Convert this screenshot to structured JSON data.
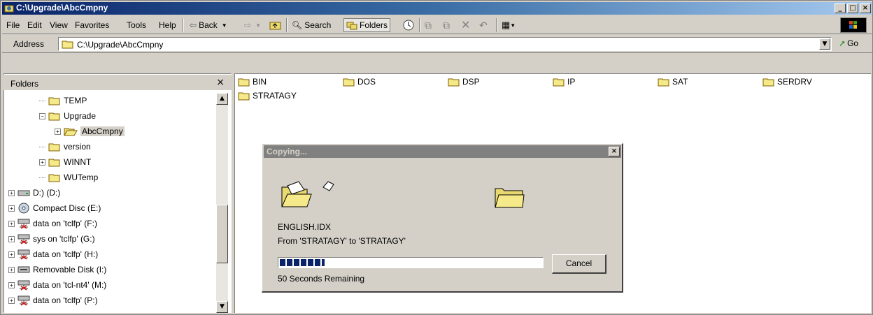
{
  "window": {
    "title": "C:\\Upgrade\\AbcCmpny",
    "controls": {
      "minimize": "_",
      "maximize": "□",
      "close": "×"
    }
  },
  "menu": {
    "file": "File",
    "edit": "Edit",
    "view": "View",
    "favorites": "Favorites",
    "tools": "Tools",
    "help": "Help"
  },
  "toolbar": {
    "back": "Back",
    "search": "Search",
    "folders": "Folders"
  },
  "address": {
    "label": "Address",
    "value": "C:\\Upgrade\\AbcCmpny",
    "go": "Go"
  },
  "folders_pane": {
    "title": "Folders",
    "close": "×",
    "tree": [
      {
        "label": "TEMP",
        "level": 2,
        "expander": ""
      },
      {
        "label": "Upgrade",
        "level": 2,
        "expander": "−"
      },
      {
        "label": "AbcCmpny",
        "level": 3,
        "expander": "+",
        "selected": true,
        "open": true
      },
      {
        "label": "version",
        "level": 2,
        "expander": ""
      },
      {
        "label": "WINNT",
        "level": 2,
        "expander": "+"
      },
      {
        "label": "WUTemp",
        "level": 2,
        "expander": ""
      },
      {
        "label": "D:) (D:)",
        "level": 0,
        "expander": "+",
        "icon": "drive-icon"
      },
      {
        "label": "Compact Disc (E:)",
        "level": 0,
        "expander": "+",
        "icon": "cd-icon"
      },
      {
        "label": "data on 'tclfp' (F:)",
        "level": 0,
        "expander": "+",
        "icon": "network-drive-icon"
      },
      {
        "label": "sys on 'tclfp' (G:)",
        "level": 0,
        "expander": "+",
        "icon": "network-drive-icon"
      },
      {
        "label": "data on 'tclfp' (H:)",
        "level": 0,
        "expander": "+",
        "icon": "network-drive-icon"
      },
      {
        "label": "Removable Disk (I:)",
        "level": 0,
        "expander": "+",
        "icon": "removable-drive-icon"
      },
      {
        "label": "data on 'tcl-nt4' (M:)",
        "level": 0,
        "expander": "+",
        "icon": "network-drive-icon"
      },
      {
        "label": "data on 'tclfp' (P:)",
        "level": 0,
        "expander": "+",
        "icon": "network-drive-icon"
      }
    ]
  },
  "content": {
    "folders": [
      "BIN",
      "DOS",
      "DSP",
      "IP",
      "SAT",
      "SERDRV",
      "STRATAGY"
    ]
  },
  "dialog": {
    "title": "Copying...",
    "close": "×",
    "file": "ENGLISH.IDX",
    "from_to": "From 'STRATAGY' to 'STRATAGY'",
    "progress_fraction": 0.17,
    "remaining": "50 Seconds Remaining",
    "cancel": "Cancel"
  }
}
